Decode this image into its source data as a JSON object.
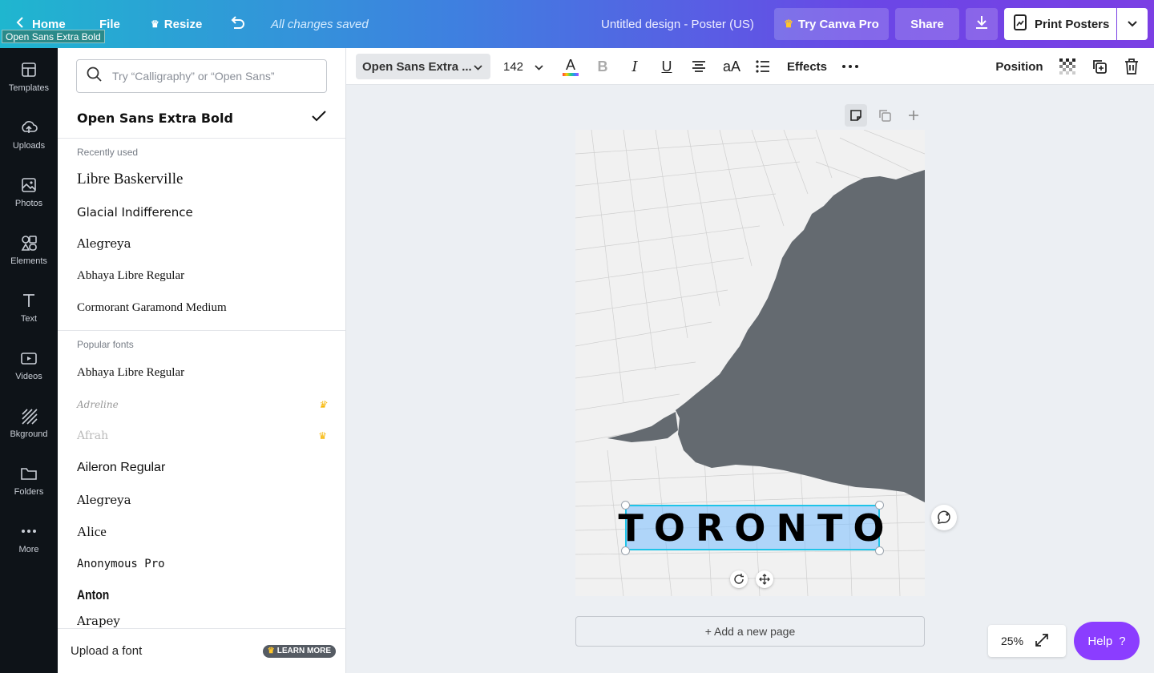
{
  "tooltip": "Open Sans Extra Bold",
  "topbar": {
    "home_label": "Home",
    "file_label": "File",
    "resize_label": "Resize",
    "saved_status": "All changes saved",
    "doc_title": "Untitled design - Poster (US)",
    "pro_label": "Try Canva Pro",
    "share_label": "Share",
    "print_label": "Print Posters"
  },
  "rail": {
    "items": [
      {
        "label": "Templates",
        "icon": "templates-icon"
      },
      {
        "label": "Uploads",
        "icon": "uploads-icon"
      },
      {
        "label": "Photos",
        "icon": "photos-icon"
      },
      {
        "label": "Elements",
        "icon": "elements-icon"
      },
      {
        "label": "Text",
        "icon": "text-icon"
      },
      {
        "label": "Videos",
        "icon": "videos-icon"
      },
      {
        "label": "Bkground",
        "icon": "background-icon"
      },
      {
        "label": "Folders",
        "icon": "folders-icon"
      },
      {
        "label": "More",
        "icon": "more-icon"
      }
    ]
  },
  "panel": {
    "search_placeholder": "Try “Calligraphy” or “Open Sans”",
    "current_font": "Open Sans Extra Bold",
    "recent_label": "Recently used",
    "recent": [
      "Libre Baskerville",
      "Glacial Indifference",
      "Alegreya",
      "Abhaya Libre Regular",
      "Cormorant Garamond Medium"
    ],
    "popular_label": "Popular fonts",
    "popular": [
      {
        "name": "Abhaya Libre Regular",
        "pro": false
      },
      {
        "name": "Adreline",
        "pro": true
      },
      {
        "name": "Afrah",
        "pro": true
      },
      {
        "name": "Aileron Regular",
        "pro": false
      },
      {
        "name": "Alegreya",
        "pro": false
      },
      {
        "name": "Alice",
        "pro": false
      },
      {
        "name": "Anonymous Pro",
        "pro": false
      },
      {
        "name": "Anton",
        "pro": false
      },
      {
        "name": "Arapey",
        "pro": false
      }
    ],
    "upload_label": "Upload a font",
    "learn_more": "LEARN MORE"
  },
  "toolbar": {
    "font_name": "Open Sans Extra ...",
    "font_size": "142",
    "effects_label": "Effects",
    "position_label": "Position",
    "text_color": "#ff3b3b"
  },
  "canvas": {
    "poster_text": "TORONTO",
    "add_page_label": "+ Add a new page"
  },
  "zoom": {
    "level": "25%"
  },
  "help_label": "Help",
  "help_icon": "?"
}
